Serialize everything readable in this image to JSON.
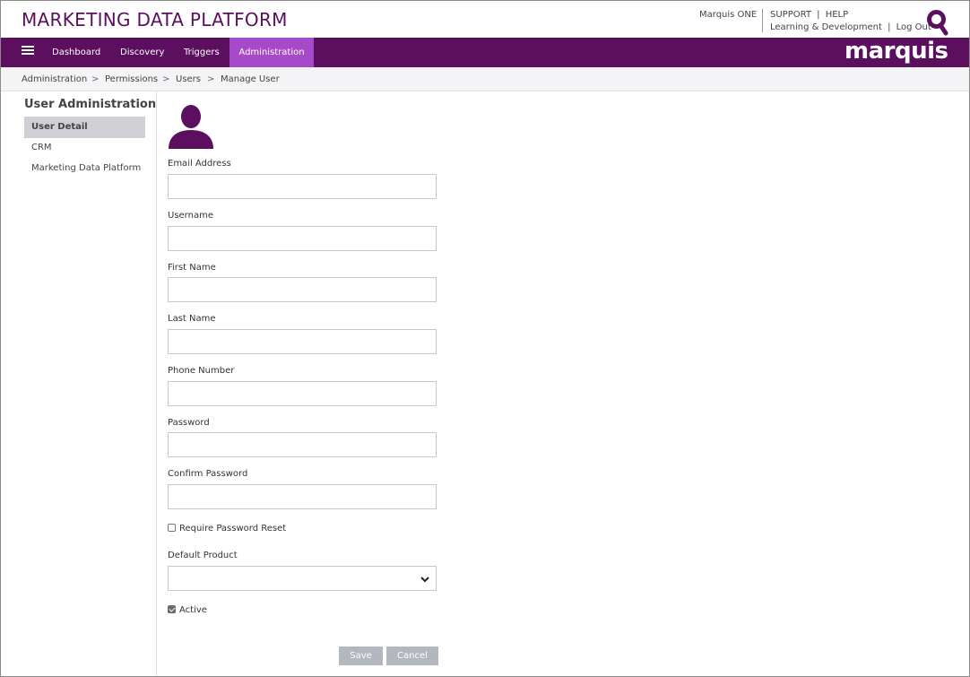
{
  "header": {
    "app_title": "MARKETING DATA PLATFORM",
    "marquis_one": "Marquis ONE",
    "support": "SUPPORT",
    "help": "HELP",
    "learning": "Learning & Development",
    "logout": "Log Out",
    "link_separator": "|"
  },
  "nav": {
    "items": [
      {
        "label": "Dashboard"
      },
      {
        "label": "Discovery"
      },
      {
        "label": "Triggers"
      },
      {
        "label": "Administration"
      }
    ],
    "active": "Administration",
    "brand": "marquis"
  },
  "breadcrumb": {
    "items": [
      "Administration",
      "Permissions",
      "Users",
      "Manage User"
    ],
    "separator": ">"
  },
  "sidebar": {
    "title": "User Administration",
    "items": [
      {
        "label": "User Detail"
      },
      {
        "label": "CRM"
      },
      {
        "label": "Marketing Data Platform"
      }
    ],
    "active": "User Detail"
  },
  "form": {
    "email_label": "Email Address",
    "email_value": "",
    "username_label": "Username",
    "username_value": "",
    "first_name_label": "First Name",
    "first_name_value": "",
    "last_name_label": "Last Name",
    "last_name_value": "",
    "phone_label": "Phone Number",
    "phone_value": "",
    "password_label": "Password",
    "password_value": "",
    "confirm_password_label": "Confirm Password",
    "confirm_password_value": "",
    "require_reset_label": "Require Password Reset",
    "require_reset_checked": false,
    "default_product_label": "Default Product",
    "default_product_value": "",
    "active_label": "Active",
    "active_checked": true,
    "save_label": "Save",
    "cancel_label": "Cancel"
  },
  "icons": {
    "avatar": "user-avatar-icon",
    "search": "search-icon",
    "menu": "hamburger-menu-icon",
    "select_arrow": "chevron-down-icon"
  },
  "colors": {
    "brand_purple": "#5b0f5e",
    "active_tab": "#a64ac9",
    "button_gray": "#b3b7bf",
    "sidebar_active": "#cfd0d6"
  }
}
